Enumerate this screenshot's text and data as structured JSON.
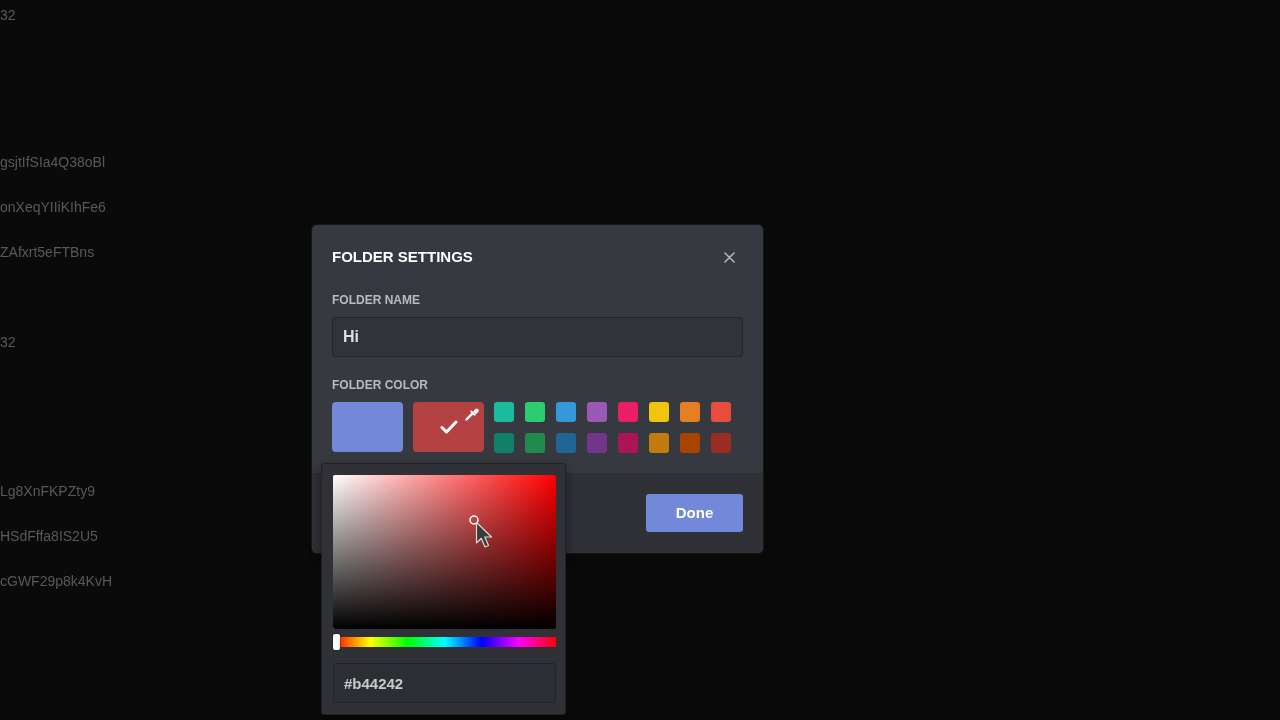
{
  "background_messages": [
    {
      "lines": [
        "32"
      ]
    },
    {
      "lines": [
        "gsjtIfSIa4Q38oBl",
        "onXeqYIIiKIhFe6",
        "ZAfxrt5eFTBns"
      ]
    },
    {
      "lines": [
        "32"
      ]
    },
    {
      "lines": [
        "Lg8XnFKPZty9",
        "HSdFffa8IS2U5",
        "cGWF29p8k4KvH"
      ]
    }
  ],
  "dialog": {
    "title": "FOLDER SETTINGS",
    "folder_name": {
      "label": "FOLDER NAME",
      "value": "Hi"
    },
    "folder_color": {
      "label": "FOLDER COLOR",
      "default_swatch": {
        "color": "#7289da",
        "selected": false
      },
      "custom_swatch": {
        "color": "#b44242",
        "selected": true
      },
      "swatches": [
        {
          "color": "#1abc9c",
          "selected": false
        },
        {
          "color": "#2ecc71",
          "selected": false
        },
        {
          "color": "#3498db",
          "selected": false
        },
        {
          "color": "#9b59b6",
          "selected": false
        },
        {
          "color": "#e91e63",
          "selected": false
        },
        {
          "color": "#f1c40f",
          "selected": false
        },
        {
          "color": "#e67e22",
          "selected": false
        },
        {
          "color": "#e74c3c",
          "selected": false
        },
        {
          "color": "#11806a",
          "selected": false
        },
        {
          "color": "#1f8b4c",
          "selected": false
        },
        {
          "color": "#206694",
          "selected": false
        },
        {
          "color": "#71368a",
          "selected": false
        },
        {
          "color": "#ad1457",
          "selected": false
        },
        {
          "color": "#c27c0e",
          "selected": false
        },
        {
          "color": "#a84300",
          "selected": false
        },
        {
          "color": "#992d22",
          "selected": false
        }
      ]
    },
    "done_button": "Done"
  },
  "color_picker": {
    "hue": {
      "level": 0
    },
    "hex_value": "#b44242"
  }
}
